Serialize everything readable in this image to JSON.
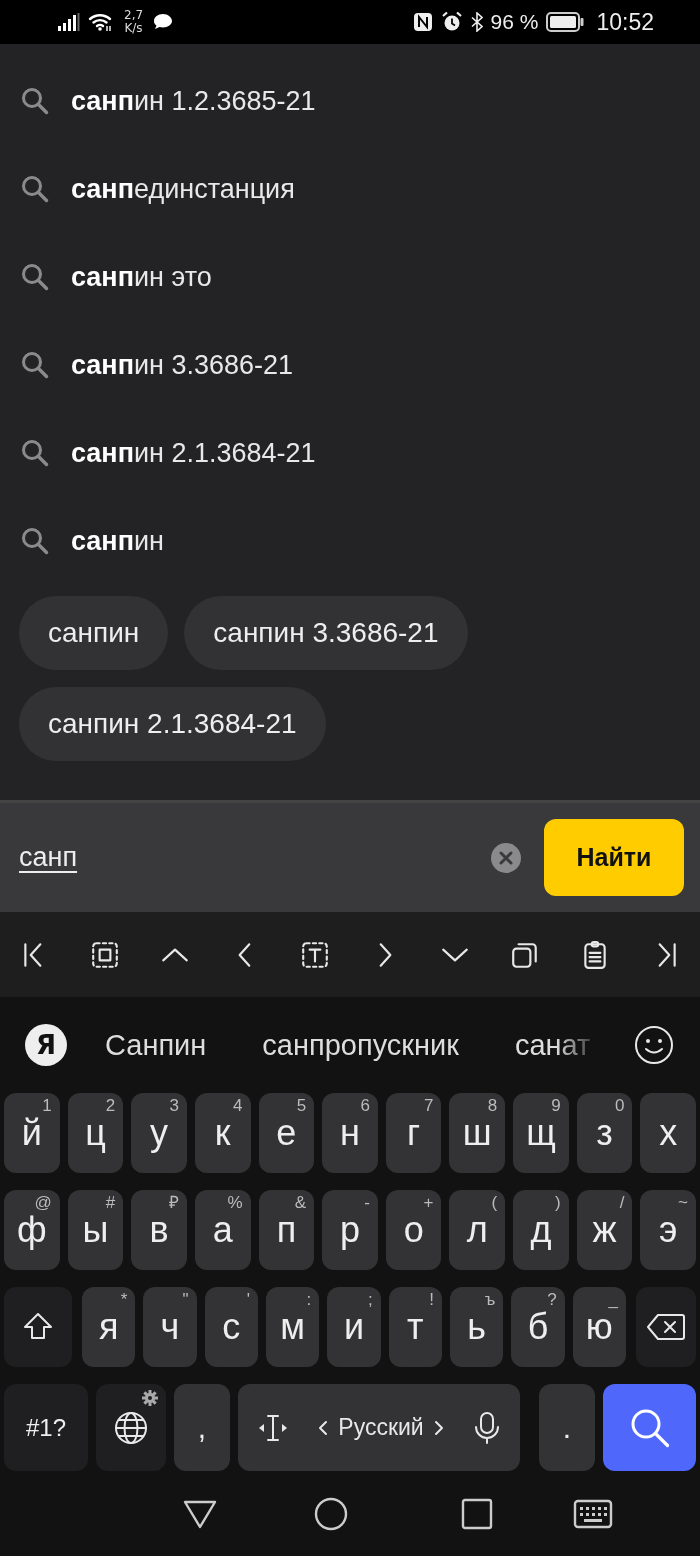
{
  "status_bar": {
    "speed_value": "2,7",
    "speed_unit": "K/s",
    "battery": "96 %",
    "time": "10:52"
  },
  "suggestions": [
    {
      "text": "**санп**ин 1.2.3685-21"
    },
    {
      "text": "**санп**единстанция"
    },
    {
      "text": "**санп**ин это"
    },
    {
      "text": "**санп**ин 3.3686-21"
    },
    {
      "text": "**санп**ин 2.1.3684-21"
    },
    {
      "text": "**санп**ин"
    }
  ],
  "chips": [
    {
      "label": "санпин"
    },
    {
      "label": "санпин 3.3686-21"
    },
    {
      "label": "санпин 2.1.3684-21"
    }
  ],
  "search": {
    "value": "санп",
    "button": "Найти"
  },
  "keyboard": {
    "logo": "Я",
    "suggestions": [
      {
        "text": "Санпин",
        "faded": false
      },
      {
        "text": "санпропускник",
        "faded": false
      },
      {
        "text": "санат",
        "faded": true
      }
    ],
    "rows": [
      {
        "keys": [
          {
            "kind": "letter",
            "label": "й",
            "hint": "1"
          },
          {
            "kind": "letter",
            "label": "ц",
            "hint": "2"
          },
          {
            "kind": "letter",
            "label": "у",
            "hint": "3"
          },
          {
            "kind": "letter",
            "label": "к",
            "hint": "4"
          },
          {
            "kind": "letter",
            "label": "е",
            "hint": "5"
          },
          {
            "kind": "letter",
            "label": "н",
            "hint": "6"
          },
          {
            "kind": "letter",
            "label": "г",
            "hint": "7"
          },
          {
            "kind": "letter",
            "label": "ш",
            "hint": "8"
          },
          {
            "kind": "letter",
            "label": "щ",
            "hint": "9"
          },
          {
            "kind": "letter",
            "label": "з",
            "hint": "0"
          },
          {
            "kind": "letter",
            "label": "х"
          }
        ]
      },
      {
        "keys": [
          {
            "kind": "letter",
            "label": "ф",
            "hint": "@"
          },
          {
            "kind": "letter",
            "label": "ы",
            "hint": "#"
          },
          {
            "kind": "letter",
            "label": "в",
            "hint": "₽"
          },
          {
            "kind": "letter",
            "label": "а",
            "hint": "%"
          },
          {
            "kind": "letter",
            "label": "п",
            "hint": "&"
          },
          {
            "kind": "letter",
            "label": "р",
            "hint": "-"
          },
          {
            "kind": "letter",
            "label": "о",
            "hint": "+"
          },
          {
            "kind": "letter",
            "label": "л",
            "hint": "("
          },
          {
            "kind": "letter",
            "label": "д",
            "hint": ")"
          },
          {
            "kind": "letter",
            "label": "ж",
            "hint": "/"
          },
          {
            "kind": "letter",
            "label": "э",
            "hint": "~"
          }
        ]
      },
      {
        "keys": [
          {
            "kind": "shift"
          },
          {
            "kind": "letter",
            "label": "я",
            "hint": "*"
          },
          {
            "kind": "letter",
            "label": "ч",
            "hint": "\""
          },
          {
            "kind": "letter",
            "label": "с",
            "hint": "'"
          },
          {
            "kind": "letter",
            "label": "м",
            "hint": ":"
          },
          {
            "kind": "letter",
            "label": "и",
            "hint": ";"
          },
          {
            "kind": "letter",
            "label": "т",
            "hint": "!"
          },
          {
            "kind": "letter",
            "label": "ь",
            "hint": "ъ"
          },
          {
            "kind": "letter",
            "label": "б",
            "hint": "?"
          },
          {
            "kind": "letter",
            "label": "ю",
            "hint": "_"
          },
          {
            "kind": "backspace"
          }
        ]
      }
    ],
    "bottom_row": {
      "keys": [
        {
          "kind": "symbols",
          "label": "#1?"
        },
        {
          "kind": "globe"
        },
        {
          "kind": "punct",
          "label": ","
        },
        {
          "kind": "space",
          "label": "Русский"
        },
        {
          "kind": "punct",
          "label": "."
        },
        {
          "kind": "search"
        }
      ]
    }
  }
}
